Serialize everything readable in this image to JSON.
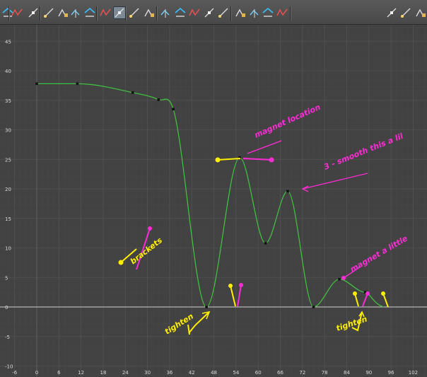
{
  "toolbar": {
    "tools": [
      {
        "name": "insert-key-tool",
        "icon": "insert-key-icon"
      },
      {
        "name": "lattice-deform-tool",
        "icon": "lattice-icon"
      },
      {
        "name": "move-key-tool",
        "icon": "move-key-icon"
      },
      {
        "name": "tangent-tool",
        "icon": "tangent-icon"
      },
      {
        "name": "break-tangent-tool",
        "icon": "break-tangent-icon"
      },
      {
        "name": "lock-tangent-tool",
        "icon": "lock-tangent-icon"
      },
      {
        "name": "frame-all-tool",
        "icon": "frame-all-icon"
      },
      {
        "name": "frame-selection-tool",
        "icon": "frame-selection-icon"
      },
      {
        "name": "auto-tangent-tool",
        "icon": "auto-tangent-icon"
      },
      {
        "name": "spline-tangent-tool",
        "icon": "spline-tangent-icon"
      },
      {
        "name": "clamped-tangent-tool",
        "icon": "clamped-tangent-icon"
      },
      {
        "name": "linear-tangent-tool",
        "icon": "linear-tangent-icon"
      },
      {
        "name": "flat-tangent-tool",
        "icon": "flat-tangent-icon"
      },
      {
        "name": "step-tangent-tool",
        "icon": "step-tangent-icon"
      },
      {
        "name": "plateau-tangent-tool",
        "icon": "plateau-tangent-icon"
      },
      {
        "name": "buffer-curve-tool",
        "icon": "buffer-curve-icon"
      },
      {
        "name": "swap-buffer-tool",
        "icon": "swap-buffer-icon"
      },
      {
        "name": "unify-tangents-tool",
        "icon": "unify-tangents-icon"
      },
      {
        "name": "break-tangents-tool",
        "icon": "break-tangents-icon"
      },
      {
        "name": "free-tangent-weight-tool",
        "icon": "free-weight-icon"
      },
      {
        "name": "lock-tangent-weight-tool",
        "icon": "lock-weight-icon"
      },
      {
        "name": "curve-editor-tool",
        "icon": "curve-editor-icon"
      },
      {
        "name": "dope-sheet-tool",
        "icon": "dope-sheet-icon"
      },
      {
        "name": "trax-editor-tool",
        "icon": "trax-editor-icon"
      }
    ],
    "active_tools": [
      "auto-tangent-tool"
    ]
  },
  "graph": {
    "x_ticks": [
      "-6",
      "0",
      "6",
      "12",
      "18",
      "24",
      "30",
      "36",
      "42",
      "48",
      "54",
      "60",
      "66",
      "72",
      "78",
      "84",
      "90",
      "96",
      "102"
    ],
    "y_ticks": [
      "45",
      "40",
      "35",
      "30",
      "25",
      "20",
      "15",
      "10",
      "5",
      "0",
      "-5",
      "-10"
    ],
    "curve_color": "#3fbf3f",
    "keyframes": [
      {
        "frame": 0,
        "value": 37.8
      },
      {
        "frame": 11,
        "value": 37.8
      },
      {
        "frame": 26,
        "value": 36.3
      },
      {
        "frame": 33,
        "value": 35.1
      },
      {
        "frame": 37,
        "value": 33.5
      },
      {
        "frame": 46,
        "value": 0
      },
      {
        "frame": 55,
        "value": 25.3
      },
      {
        "frame": 62,
        "value": 10.8
      },
      {
        "frame": 68,
        "value": 19.6
      },
      {
        "frame": 75,
        "value": 0
      },
      {
        "frame": 82,
        "value": 4.7
      },
      {
        "frame": 89,
        "value": 2.5
      }
    ],
    "annotations": {
      "magnet_location": "magnet location",
      "smooth_note": "3 - smooth this a lil",
      "magnet_little": "magnet a little",
      "brackets": "brackets",
      "tighten_left": "tighten",
      "tighten_right": "tighten"
    },
    "annotation_colors": {
      "magenta": "#ff2bd6",
      "yellow": "#ffee00"
    }
  }
}
